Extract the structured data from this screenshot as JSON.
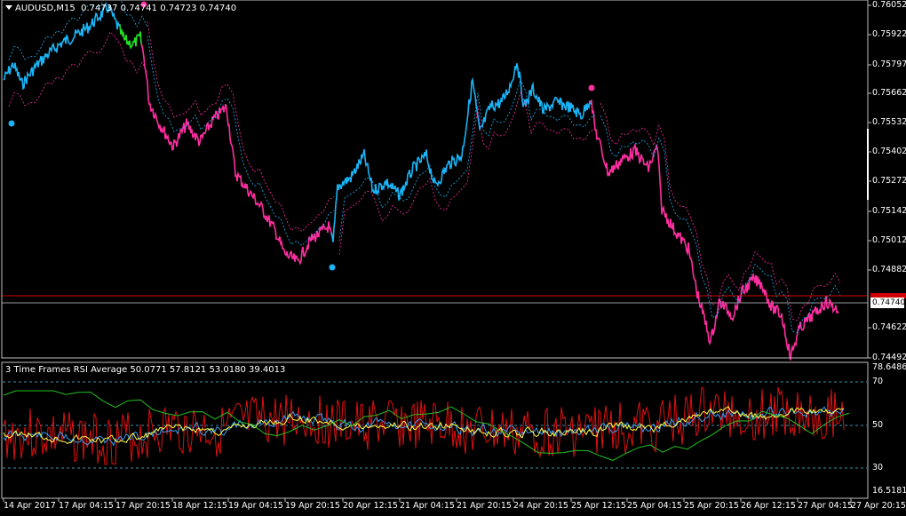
{
  "main_panel": {
    "symbol_line": {
      "symbol": "AUDUSD,M15",
      "ohlc": "0.74737 0.74741 0.74723 0.74740"
    },
    "price_axis": [
      "0.76052",
      "0.75922",
      "0.75797",
      "0.75662",
      "0.75532",
      "0.75402",
      "0.75272",
      "0.75142",
      "0.75012",
      "0.74882",
      "0.74622",
      "0.74492"
    ],
    "current_price": "0.74740",
    "colors": {
      "up_trend": "#1ab3f5",
      "down_trend": "#ff2ea0",
      "neutral": "#22e022",
      "red_line": "#d00000",
      "white_line": "#ffffff"
    }
  },
  "sub_panel": {
    "title": "3 Time Frames RSI Average 50.0771 57.8121 53.0180 39.4013",
    "axis": [
      "78.6486",
      "70",
      "50",
      "30",
      "16.5181"
    ],
    "levels": [
      70,
      50,
      30
    ],
    "colors": {
      "line1": "#e01010",
      "line2": "#ffff44",
      "line3": "#3a9ef0",
      "line4": "#22c022"
    }
  },
  "time_axis": [
    "14 Apr 2017",
    "17 Apr 04:15",
    "17 Apr 20:15",
    "18 Apr 12:15",
    "19 Apr 04:15",
    "19 Apr 20:15",
    "20 Apr 12:15",
    "21 Apr 04:15",
    "21 Apr 20:15",
    "24 Apr 20:15",
    "25 Apr 12:15",
    "25 Apr 04:15",
    "25 Apr 20:15",
    "26 Apr 12:15",
    "27 Apr 04:15",
    "27 Apr 20:15"
  ]
}
